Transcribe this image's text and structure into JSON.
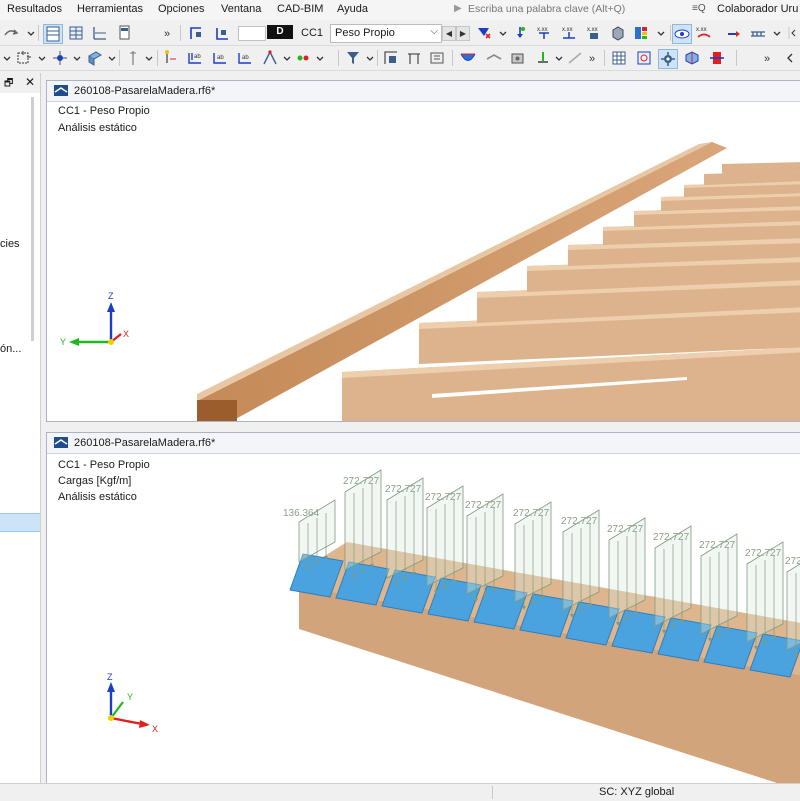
{
  "menu": [
    "Resultados",
    "Herramientas",
    "Opciones",
    "Ventana",
    "CAD-BIM",
    "Ayuda"
  ],
  "search": {
    "placeholder": "Escriba una palabra clave (Alt+Q)",
    "icon": "play-icon"
  },
  "collaborator": "Colaborador Uru",
  "load_case": {
    "tag": "D",
    "code": "CC1",
    "name": "Peso Propio"
  },
  "panel": {
    "icon_buttons": [
      "restore-icon",
      "close-icon"
    ],
    "fragments": [
      {
        "text": "cies"
      },
      {
        "text": "ón..."
      }
    ]
  },
  "viewport_top": {
    "title": "260108-PasarelaMadera.rf6*",
    "info": [
      "CC1 - Peso Propio",
      "Análisis estático"
    ],
    "axes": {
      "x": "X",
      "y": "Y",
      "z": "Z"
    }
  },
  "viewport_bottom": {
    "title": "260108-PasarelaMadera.rf6*",
    "info": [
      "CC1 - Peso Propio",
      "Cargas [Kgf/m]",
      "Análisis estático"
    ],
    "axes": {
      "x": "X",
      "y": "Y",
      "z": "Z"
    },
    "load_labels": [
      "136.364",
      "272.727",
      "272.727",
      "272.727",
      "272.727",
      "272.727",
      "272.727",
      "272.727",
      "272.727",
      "272.727",
      "272.727",
      "272.727"
    ]
  },
  "status": {
    "coord_system": "SC: XYZ global"
  },
  "colors": {
    "wood": "#d9b08a",
    "wood_dark": "#b07a4a",
    "glass": "#4aa3df",
    "load_line": "#7d9c7d",
    "axis_x": "#e02020",
    "axis_y": "#1fb81f",
    "axis_z": "#1c3ec7"
  }
}
